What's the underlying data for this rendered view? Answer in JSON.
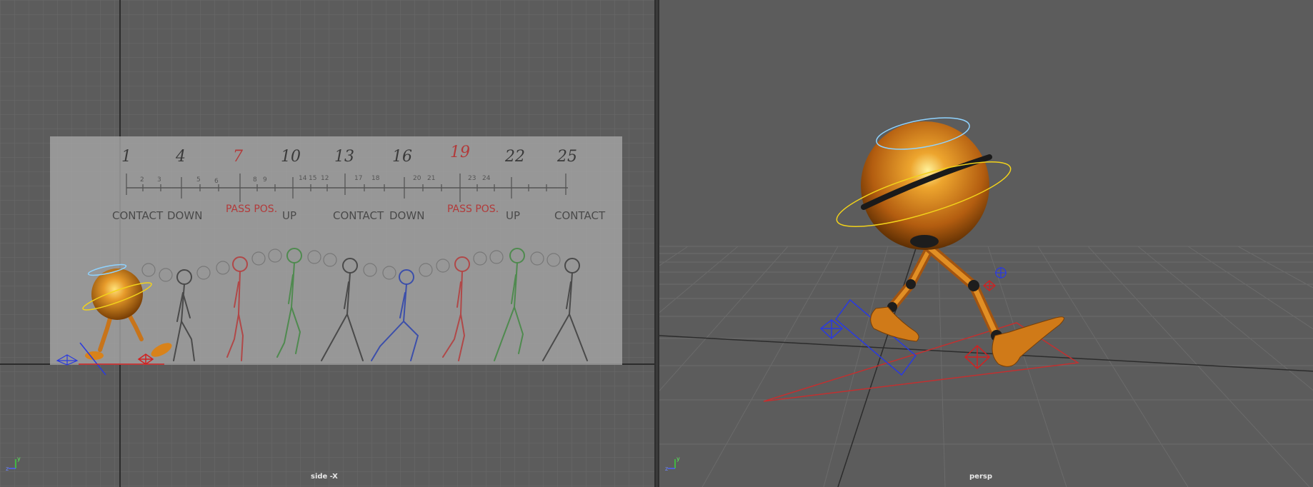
{
  "viewports": {
    "side": {
      "label": "side -X",
      "reference_sheet": {
        "frame_numbers": [
          "1",
          "4",
          "7",
          "10",
          "13",
          "16",
          "19",
          "22",
          "25"
        ],
        "small_frame_numbers": [
          "2",
          "3",
          "5",
          "6",
          "8",
          "9",
          "14",
          "15",
          "12",
          "17",
          "18",
          "20",
          "21",
          "23",
          "24"
        ],
        "poses": [
          "CONTACT",
          "DOWN",
          "PASS POS.",
          "UP",
          "CONTACT",
          "DOWN",
          "PASS POS.",
          "UP",
          "CONTACT"
        ]
      }
    },
    "persp": {
      "label": "persp"
    }
  },
  "axis_labels": {
    "y": "y",
    "z": "z"
  },
  "colors": {
    "viewport_bg": "#5c5c5c",
    "grid_line": "#6a6a6a",
    "grid_major": "#2c2c2c",
    "character_orange": "#d8821a",
    "halo_cyan": "#8fd3ff",
    "ring_yellow": "#f2d21a",
    "control_red": "#d22020",
    "control_blue": "#2a3adf"
  }
}
